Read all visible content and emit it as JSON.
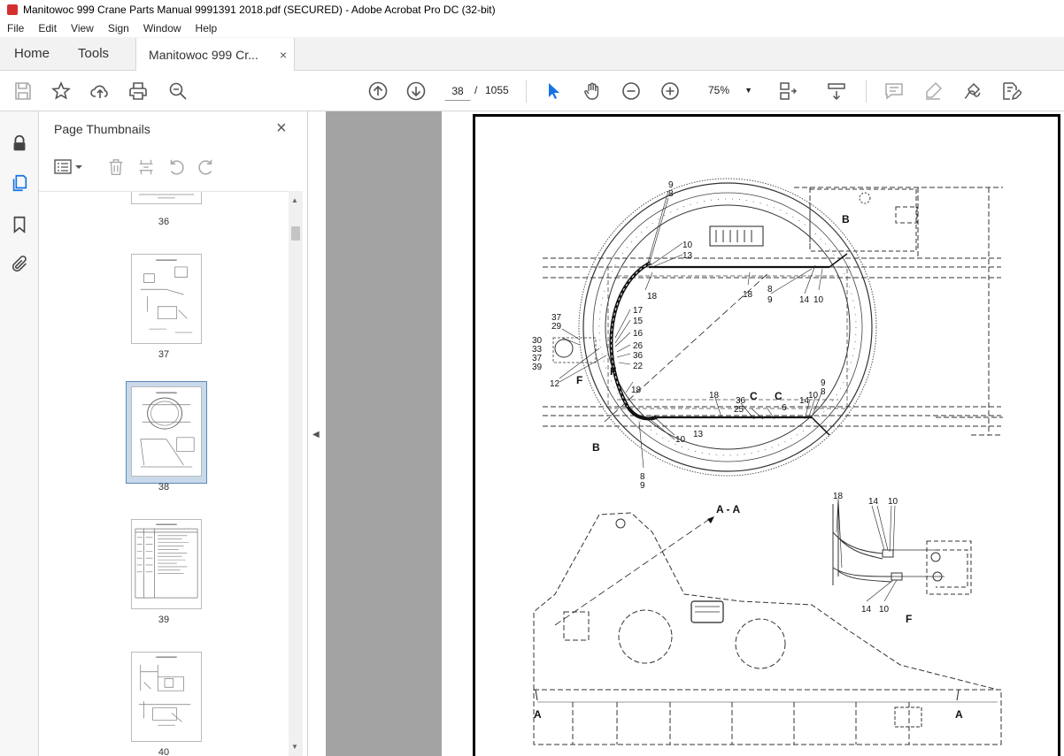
{
  "window": {
    "title": "Manitowoc 999 Crane Parts Manual 9991391 2018.pdf (SECURED) - Adobe Acrobat Pro DC (32-bit)"
  },
  "menu": [
    "File",
    "Edit",
    "View",
    "Sign",
    "Window",
    "Help"
  ],
  "tabs": {
    "home": "Home",
    "tools": "Tools",
    "document": "Manitowoc 999 Cr...",
    "close": "×"
  },
  "toolbar": {
    "current_page": "38",
    "page_separator": "/",
    "total_pages": "1055",
    "zoom": "75%"
  },
  "sidebar": {
    "title": "Page Thumbnails",
    "close": "×"
  },
  "thumbnails": [
    {
      "number": "36",
      "selected": false
    },
    {
      "number": "37",
      "selected": false
    },
    {
      "number": "38",
      "selected": true
    },
    {
      "number": "39",
      "selected": false
    },
    {
      "number": "40",
      "selected": false
    }
  ],
  "drawing": {
    "top_callouts": [
      "9",
      "8",
      "10",
      "13",
      "18",
      "18",
      "8",
      "9",
      "14",
      "10",
      "B"
    ],
    "left_callouts": [
      "37",
      "29",
      "30",
      "33",
      "37",
      "39",
      "17",
      "15",
      "16",
      "26",
      "36",
      "22",
      "12",
      "F",
      "F",
      "18",
      "10",
      "13",
      "B",
      "8",
      "9"
    ],
    "right_callouts": [
      "18",
      "36",
      "25",
      "C",
      "C",
      "6",
      "14",
      "10",
      "9",
      "8"
    ],
    "section_aa": "A - A",
    "section_labels": [
      "A",
      "A"
    ],
    "detail_f_callouts": [
      "18",
      "14",
      "10",
      "14",
      "10"
    ],
    "detail_f_label": "F"
  },
  "colors": {
    "accent": "#1473e6",
    "selection": "#c8d9ea",
    "gray_bg": "#a3a3a3"
  }
}
